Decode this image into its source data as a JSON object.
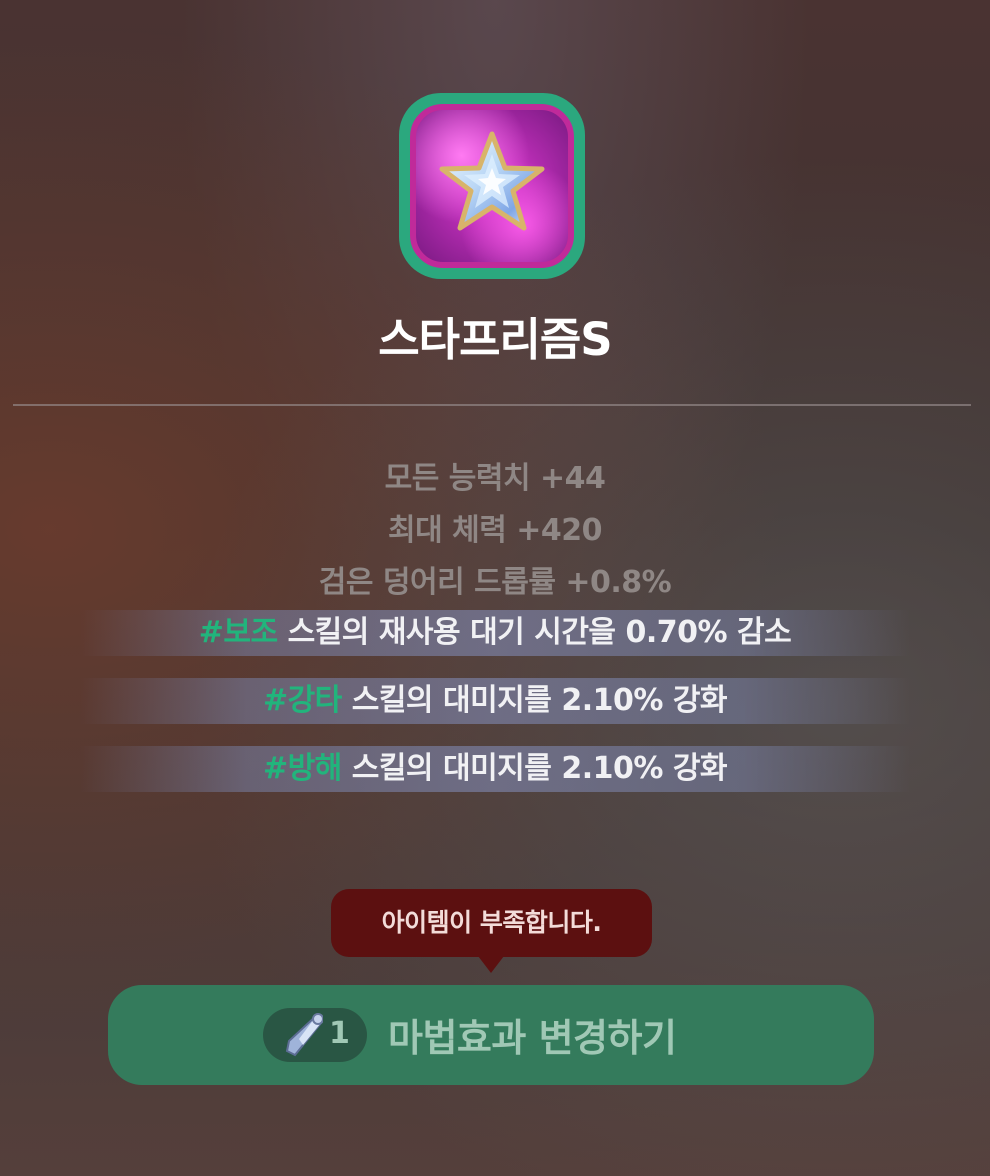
{
  "item": {
    "icon": "star-prism-icon",
    "name": "스타프리즘S",
    "frame_color": "#2ba87e",
    "border_color": "#c02a9a"
  },
  "stats": [
    "모든 능력치 +44",
    "최대 체력 +420",
    "검은 덩어리 드롭률 +0.8%"
  ],
  "options": [
    {
      "tag": "#보조",
      "text": " 스킬의 재사용 대기 시간을 0.70% 감소"
    },
    {
      "tag": "#강타",
      "text": " 스킬의 대미지를 2.10% 강화"
    },
    {
      "tag": "#방해",
      "text": " 스킬의 대미지를 2.10% 강화"
    }
  ],
  "tooltip": {
    "text": "아이템이 부족합니다."
  },
  "action_button": {
    "cost_icon": "crystal-shard-icon",
    "cost": "1",
    "label": "마법효과 변경하기"
  },
  "colors": {
    "tag": "#22b47c",
    "tooltip_bg": "#5c1010",
    "button_bg": "#347b5c"
  }
}
